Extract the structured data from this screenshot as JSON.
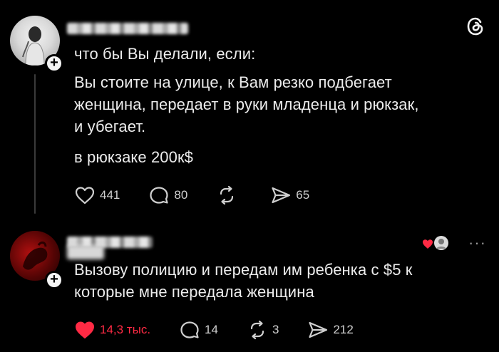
{
  "post": {
    "text_lines": [
      "что бы Вы делали, если:",
      "Вы стоите на улице, к Вам резко подбегает",
      "женщина, передает в руки младенца и рюкзак,",
      "и убегает.",
      "в рюкзаке 200к$"
    ],
    "likes": "441",
    "comments": "80",
    "shares": "65"
  },
  "reply": {
    "text_lines": [
      "Вызову полицию и передам им ребенка с $5 к",
      "которые мне передала женщина"
    ],
    "likes": "14,3 тыс.",
    "comments": "14",
    "reposts": "3",
    "shares": "212",
    "more": "···"
  },
  "colors": {
    "background": "#000000",
    "text": "#ececec",
    "like_active": "#ff2a44"
  },
  "icons": [
    "threads-logo-icon",
    "heart-icon",
    "comment-icon",
    "repost-icon",
    "share-icon",
    "plus-icon"
  ]
}
